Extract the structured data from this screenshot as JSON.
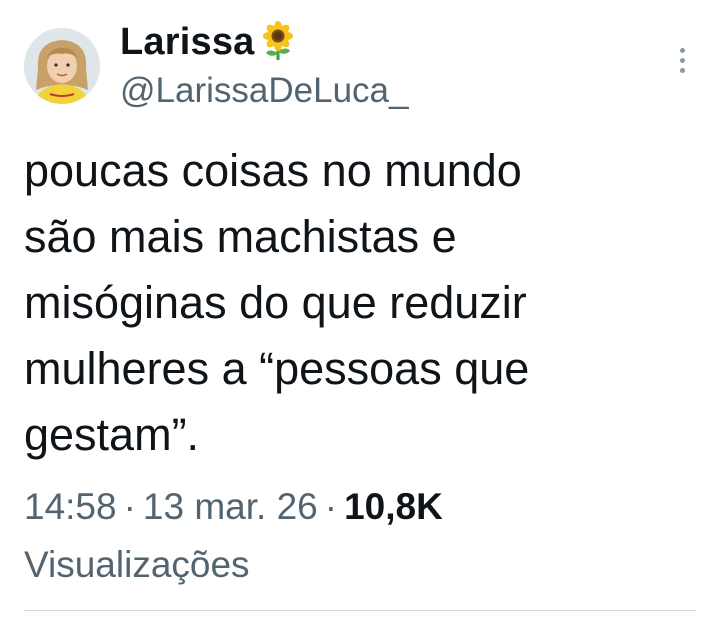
{
  "author": {
    "display_name": "Larissa",
    "name_emoji": "sunflower",
    "handle": "@LarissaDeLuca_",
    "avatar": "profile-photo"
  },
  "tweet": {
    "lines": [
      "poucas coisas no mundo",
      "são mais machistas e",
      "misóginas do que reduzir",
      "mulheres a “pessoas que",
      "gestam”."
    ],
    "time": "14:58",
    "date": "13 mar. 26",
    "separator": "·",
    "views_count": "10,8K",
    "views_label": "Visualizações"
  },
  "icons": {
    "more": "more-vertical-icon"
  },
  "colors": {
    "text": "#0f1419",
    "secondary": "#536471",
    "divider": "#cfd9de",
    "background": "#ffffff"
  }
}
